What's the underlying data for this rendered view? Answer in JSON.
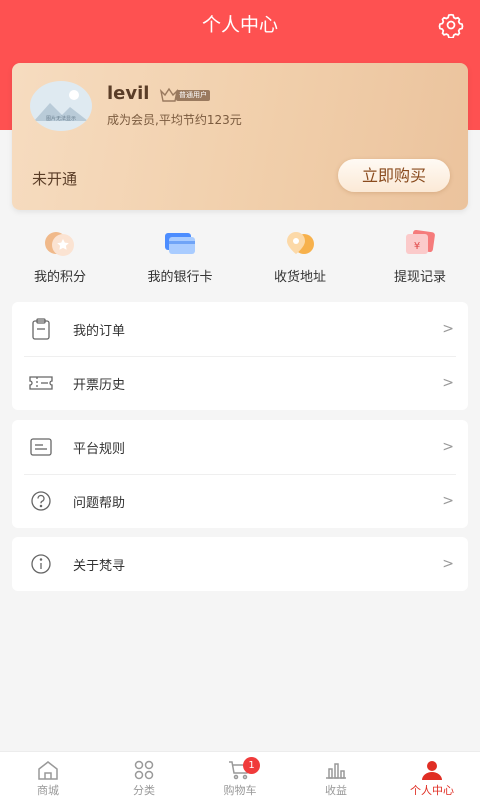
{
  "header": {
    "title": "个人中心",
    "settings_icon": "gear-icon"
  },
  "profile": {
    "username": "levil",
    "avatar_caption": "图片无法显示",
    "badge_label": "普通用户",
    "member_desc": "成为会员,平均节约123元",
    "status": "未开通",
    "buy_label": "立即购买"
  },
  "quick_links": [
    {
      "label": "我的积分",
      "icon": "points-icon"
    },
    {
      "label": "我的银行卡",
      "icon": "bank-card-icon"
    },
    {
      "label": "收货地址",
      "icon": "location-icon"
    },
    {
      "label": "提现记录",
      "icon": "withdraw-icon"
    }
  ],
  "menu_groups": [
    [
      {
        "label": "我的订单",
        "icon": "clipboard-icon",
        "arrow": ">"
      },
      {
        "label": "开票历史",
        "icon": "ticket-icon",
        "arrow": ">"
      }
    ],
    [
      {
        "label": "平台规则",
        "icon": "document-icon",
        "arrow": ">"
      },
      {
        "label": "问题帮助",
        "icon": "help-icon",
        "arrow": ">"
      }
    ],
    [
      {
        "label": "关于梵寻",
        "icon": "info-icon",
        "arrow": ">"
      }
    ]
  ],
  "tabbar": {
    "items": [
      {
        "label": "商城",
        "icon": "home-icon"
      },
      {
        "label": "分类",
        "icon": "grid-icon"
      },
      {
        "label": "购物车",
        "icon": "cart-icon"
      },
      {
        "label": "收益",
        "icon": "bar-chart-icon"
      },
      {
        "label": "个人中心",
        "icon": "person-icon"
      }
    ],
    "active_index": 4,
    "cart_count": "1"
  },
  "colors": {
    "brand_red": "#fe5151",
    "active_tab": "#e02e24",
    "card_gold": "#f1cfab"
  }
}
